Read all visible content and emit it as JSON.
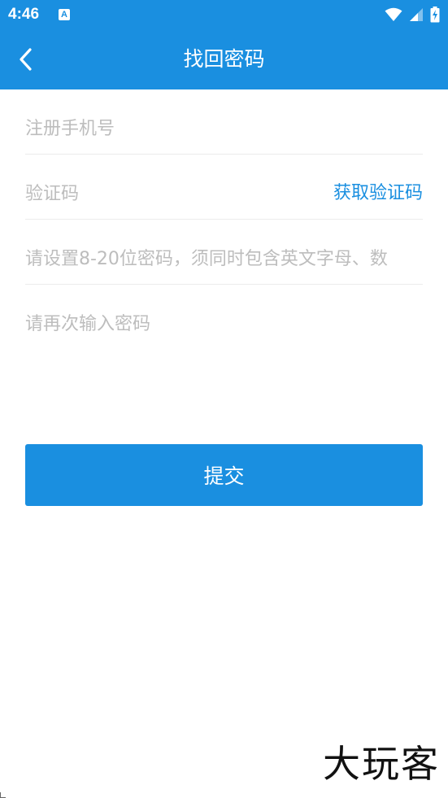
{
  "status_bar": {
    "time": "4:46",
    "notification_icon_letter": "A",
    "icons": [
      "wifi-icon",
      "signal-icon",
      "battery-charging-icon"
    ]
  },
  "app_bar": {
    "back_icon": "chevron-left-icon",
    "title": "找回密码"
  },
  "form": {
    "phone": {
      "value": "",
      "placeholder": "注册手机号"
    },
    "code": {
      "value": "",
      "placeholder": "验证码",
      "action_label": "获取验证码"
    },
    "password": {
      "value": "",
      "placeholder": "请设置8-20位密码，须同时包含英文字母、数"
    },
    "confirm_password": {
      "value": "",
      "placeholder": "请再次输入密码"
    }
  },
  "submit_label": "提交",
  "watermark": "大玩客",
  "colors": {
    "primary": "#1a8fe0",
    "placeholder": "#bdbdbd",
    "divider": "#ececec",
    "background": "#ffffff"
  }
}
